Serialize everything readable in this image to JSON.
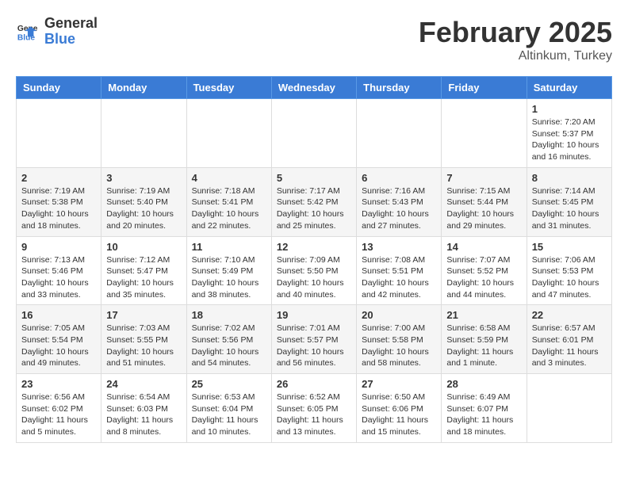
{
  "header": {
    "logo_general": "General",
    "logo_blue": "Blue",
    "month_year": "February 2025",
    "location": "Altinkum, Turkey"
  },
  "days_of_week": [
    "Sunday",
    "Monday",
    "Tuesday",
    "Wednesday",
    "Thursday",
    "Friday",
    "Saturday"
  ],
  "weeks": [
    [
      {
        "day": "",
        "info": ""
      },
      {
        "day": "",
        "info": ""
      },
      {
        "day": "",
        "info": ""
      },
      {
        "day": "",
        "info": ""
      },
      {
        "day": "",
        "info": ""
      },
      {
        "day": "",
        "info": ""
      },
      {
        "day": "1",
        "info": "Sunrise: 7:20 AM\nSunset: 5:37 PM\nDaylight: 10 hours\nand 16 minutes."
      }
    ],
    [
      {
        "day": "2",
        "info": "Sunrise: 7:19 AM\nSunset: 5:38 PM\nDaylight: 10 hours\nand 18 minutes."
      },
      {
        "day": "3",
        "info": "Sunrise: 7:19 AM\nSunset: 5:40 PM\nDaylight: 10 hours\nand 20 minutes."
      },
      {
        "day": "4",
        "info": "Sunrise: 7:18 AM\nSunset: 5:41 PM\nDaylight: 10 hours\nand 22 minutes."
      },
      {
        "day": "5",
        "info": "Sunrise: 7:17 AM\nSunset: 5:42 PM\nDaylight: 10 hours\nand 25 minutes."
      },
      {
        "day": "6",
        "info": "Sunrise: 7:16 AM\nSunset: 5:43 PM\nDaylight: 10 hours\nand 27 minutes."
      },
      {
        "day": "7",
        "info": "Sunrise: 7:15 AM\nSunset: 5:44 PM\nDaylight: 10 hours\nand 29 minutes."
      },
      {
        "day": "8",
        "info": "Sunrise: 7:14 AM\nSunset: 5:45 PM\nDaylight: 10 hours\nand 31 minutes."
      }
    ],
    [
      {
        "day": "9",
        "info": "Sunrise: 7:13 AM\nSunset: 5:46 PM\nDaylight: 10 hours\nand 33 minutes."
      },
      {
        "day": "10",
        "info": "Sunrise: 7:12 AM\nSunset: 5:47 PM\nDaylight: 10 hours\nand 35 minutes."
      },
      {
        "day": "11",
        "info": "Sunrise: 7:10 AM\nSunset: 5:49 PM\nDaylight: 10 hours\nand 38 minutes."
      },
      {
        "day": "12",
        "info": "Sunrise: 7:09 AM\nSunset: 5:50 PM\nDaylight: 10 hours\nand 40 minutes."
      },
      {
        "day": "13",
        "info": "Sunrise: 7:08 AM\nSunset: 5:51 PM\nDaylight: 10 hours\nand 42 minutes."
      },
      {
        "day": "14",
        "info": "Sunrise: 7:07 AM\nSunset: 5:52 PM\nDaylight: 10 hours\nand 44 minutes."
      },
      {
        "day": "15",
        "info": "Sunrise: 7:06 AM\nSunset: 5:53 PM\nDaylight: 10 hours\nand 47 minutes."
      }
    ],
    [
      {
        "day": "16",
        "info": "Sunrise: 7:05 AM\nSunset: 5:54 PM\nDaylight: 10 hours\nand 49 minutes."
      },
      {
        "day": "17",
        "info": "Sunrise: 7:03 AM\nSunset: 5:55 PM\nDaylight: 10 hours\nand 51 minutes."
      },
      {
        "day": "18",
        "info": "Sunrise: 7:02 AM\nSunset: 5:56 PM\nDaylight: 10 hours\nand 54 minutes."
      },
      {
        "day": "19",
        "info": "Sunrise: 7:01 AM\nSunset: 5:57 PM\nDaylight: 10 hours\nand 56 minutes."
      },
      {
        "day": "20",
        "info": "Sunrise: 7:00 AM\nSunset: 5:58 PM\nDaylight: 10 hours\nand 58 minutes."
      },
      {
        "day": "21",
        "info": "Sunrise: 6:58 AM\nSunset: 5:59 PM\nDaylight: 11 hours\nand 1 minute."
      },
      {
        "day": "22",
        "info": "Sunrise: 6:57 AM\nSunset: 6:01 PM\nDaylight: 11 hours\nand 3 minutes."
      }
    ],
    [
      {
        "day": "23",
        "info": "Sunrise: 6:56 AM\nSunset: 6:02 PM\nDaylight: 11 hours\nand 5 minutes."
      },
      {
        "day": "24",
        "info": "Sunrise: 6:54 AM\nSunset: 6:03 PM\nDaylight: 11 hours\nand 8 minutes."
      },
      {
        "day": "25",
        "info": "Sunrise: 6:53 AM\nSunset: 6:04 PM\nDaylight: 11 hours\nand 10 minutes."
      },
      {
        "day": "26",
        "info": "Sunrise: 6:52 AM\nSunset: 6:05 PM\nDaylight: 11 hours\nand 13 minutes."
      },
      {
        "day": "27",
        "info": "Sunrise: 6:50 AM\nSunset: 6:06 PM\nDaylight: 11 hours\nand 15 minutes."
      },
      {
        "day": "28",
        "info": "Sunrise: 6:49 AM\nSunset: 6:07 PM\nDaylight: 11 hours\nand 18 minutes."
      },
      {
        "day": "",
        "info": ""
      }
    ]
  ]
}
